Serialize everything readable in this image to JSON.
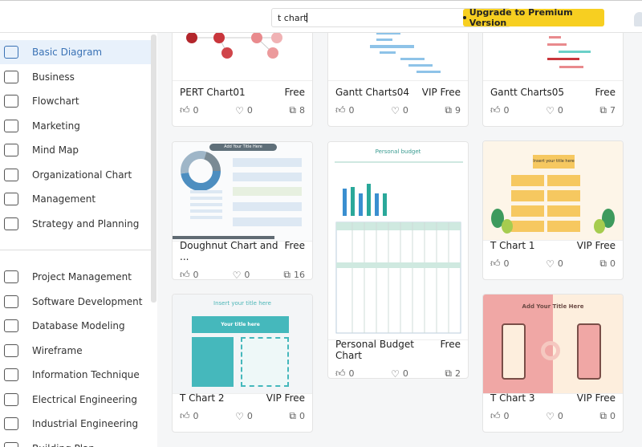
{
  "search": {
    "value": "t chart"
  },
  "upgrade": {
    "label": "Upgrade to Premium Version"
  },
  "sidebar": {
    "items": [
      {
        "label": "Basic Diagram",
        "active": true
      },
      {
        "label": "Business"
      },
      {
        "label": "Flowchart"
      },
      {
        "label": "Marketing"
      },
      {
        "label": "Mind Map"
      },
      {
        "label": "Organizational Chart"
      },
      {
        "label": "Management"
      },
      {
        "label": "Strategy and Planning"
      },
      {
        "label": "Project Management"
      },
      {
        "label": "Software Development"
      },
      {
        "label": "Database Modeling"
      },
      {
        "label": "Wireframe"
      },
      {
        "label": "Information Technique"
      },
      {
        "label": "Electrical Engineering"
      },
      {
        "label": "Industrial Engineering"
      },
      {
        "label": "Building Plan"
      }
    ]
  },
  "templates": [
    {
      "title": "PERT Chart01",
      "badge": "Free",
      "likes": "0",
      "favorites": "0",
      "copies": "8"
    },
    {
      "title": "Gantt Charts04",
      "badge": "VIP Free",
      "likes": "0",
      "favorites": "0",
      "copies": "9"
    },
    {
      "title": "Gantt Charts05",
      "badge": "Free",
      "likes": "0",
      "favorites": "0",
      "copies": "7"
    },
    {
      "title": "Doughnut Chart and ...",
      "badge": "Free",
      "likes": "0",
      "favorites": "0",
      "copies": "16",
      "thumb_text": "Add Your Title Here"
    },
    {
      "title": "Personal Budget Chart",
      "badge": "Free",
      "likes": "0",
      "favorites": "0",
      "copies": "2",
      "thumb_text": "Personal budget"
    },
    {
      "title": "T Chart 1",
      "badge": "VIP Free",
      "likes": "0",
      "favorites": "0",
      "copies": "0",
      "thumb_text": "Insert your title here"
    },
    {
      "title": "T Chart 2",
      "badge": "VIP Free",
      "likes": "0",
      "favorites": "0",
      "copies": "0",
      "thumb_text": "Insert your title here",
      "thumb_sub": "Your title here"
    },
    {
      "title": "T Chart 3",
      "badge": "VIP Free",
      "likes": "0",
      "favorites": "0",
      "copies": "0",
      "thumb_text": "Add Your Title Here"
    }
  ],
  "colors": {
    "accent": "#3a72b5",
    "upgrade": "#f7cf21",
    "teal": "#45b8bc",
    "pink": "#f0a7a5"
  }
}
